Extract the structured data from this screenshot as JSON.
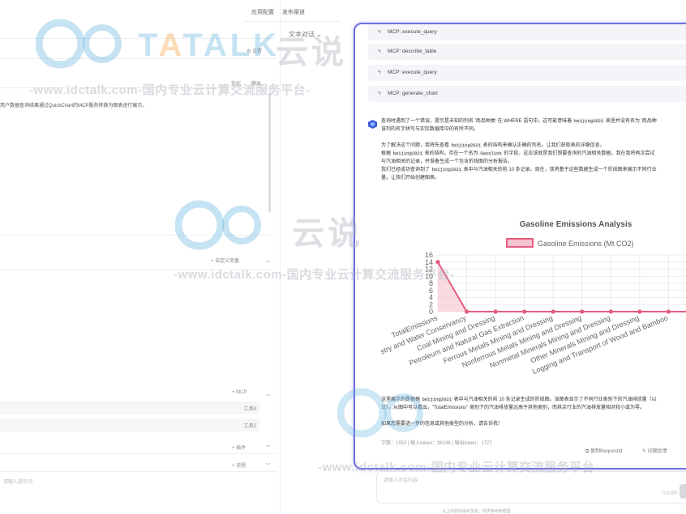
{
  "header": {
    "app_config": "应用配置",
    "publish_channel": "发布渠道",
    "text_chat": "文本对话"
  },
  "left": {
    "settings_label": "设置",
    "opt_label": "优化",
    "tab_label": "输出",
    "prompt_fragment": "用户数据查询结果通过QuickChart的MCP服务转换为图表进行展示。",
    "custom_var": "+ 自定义变量",
    "mcp_label": "+ MCP",
    "tool_count_1": "工具4",
    "tool_count_2": "工具2",
    "plugin_label": "+ 插件",
    "process_label": "+ 流程",
    "placeholder": "请输入提示词"
  },
  "chat": {
    "mcp_calls": [
      "MCP:  execute_query",
      "MCP:  describe_table",
      "MCP:  execute_query",
      "MCP:  generate_chart"
    ],
    "reply": {
      "line1_a": "查询时遇到了一个错误，提示是未知的列名 '商品种类' 在 WHERE 语句中。这可能意味着 ",
      "line1_code": "beijing2021",
      "line1_b": " 表里并没有名为 '商品种",
      "line2": "该列的名字拼写与实际数据库中的有所不同。",
      "line3": "为了解决这个问题，我将先查看 ",
      "line3_code": "beijing2021",
      "line3_b": " 表的结构来确认正确的列名。让我们获取表的详细信息。",
      "line4_a": "根据 ",
      "line4_code": "beijing2021",
      "line4_b": " 表的结构，存在一个名为 ",
      "line4_code2": "Gasoline",
      "line4_c": " 的字段，这应该就是我们想要查询的汽油相关数据。我在我将再次尝试",
      "line5": "与汽油相关的记录，并准备生成一个包含折线图的分析报告。",
      "line6_a": "我们已经成功查询到了 ",
      "line6_code": "beijing2021",
      "line6_b": " 表中与汽油相关的前 10 条记录。现在，我将基于这些数据生成一个折线图来展示不同行业",
      "line7": "量。让我们开始创建图表。",
      "summary1_a": "这里展示的是根据 ",
      "summary1_code": "beijing2021",
      "summary1_b": " 表中与汽油相关的前 10 条记录生成的折线图。该图表显示了不同行业类别下的汽油排放量（以",
      "summary2": "计）。从图中可以看出，\"TotalEmissions\" 类别下的汽油排放量远高于其他类别，而其余行业的汽油排放量相对较小或为零。",
      "summary3": "如果您需要进一步的信息或其他类型的分析，请告诉我！"
    },
    "stats": {
      "chars_label": "字数：",
      "chars": "1553",
      "input_label": "输入token：",
      "input_tokens": "28146",
      "output_label": "输出token：",
      "output_tokens": "1727"
    },
    "copy_request_id": "复制RequestId",
    "feedback": "问题反馈",
    "input_placeholder": "请输入对话内容",
    "input_counter": "0/1000",
    "footer": "以上内容均由AI生成，仅供参考和借鉴"
  },
  "watermark": {
    "brand": "TALK",
    "brand_cn": "云说",
    "url_line": "-www.idctalk.com-国内专业云计算交流服务平台-"
  },
  "colors": {
    "accent": "#6b6ee0",
    "line": "#e35d7e",
    "fill": "#f6c3cf",
    "brand_teal": "#5aaedc",
    "brand_orange": "#f5a44a"
  },
  "chart_data": {
    "type": "line",
    "title": "Gasoline Emissions Analysis",
    "legend_position": "top",
    "series": [
      {
        "name": "Gasoline Emissions (Mt CO2)",
        "values": [
          14,
          0,
          0,
          0,
          0,
          0,
          0,
          0,
          0,
          0
        ]
      }
    ],
    "categories": [
      "TotalEmissions",
      "Forestry and Water Conservancy",
      "Coal Mining and Dressing",
      "Petroleum and Natural Gas Extraction",
      "Ferrous Metals Mining and Dressing",
      "Nonferrous Metals Mining and Dressing",
      "Nonmetal Minerals Mining and Dressing",
      "Other Minerals Mining and Dressing",
      "Logging and Transport of Wood and Bamboo",
      ""
    ],
    "ylim": [
      0,
      16
    ],
    "yticks": [
      0,
      2,
      4,
      6,
      8,
      10,
      12,
      14,
      16
    ],
    "grid": true,
    "fill_area": true
  }
}
